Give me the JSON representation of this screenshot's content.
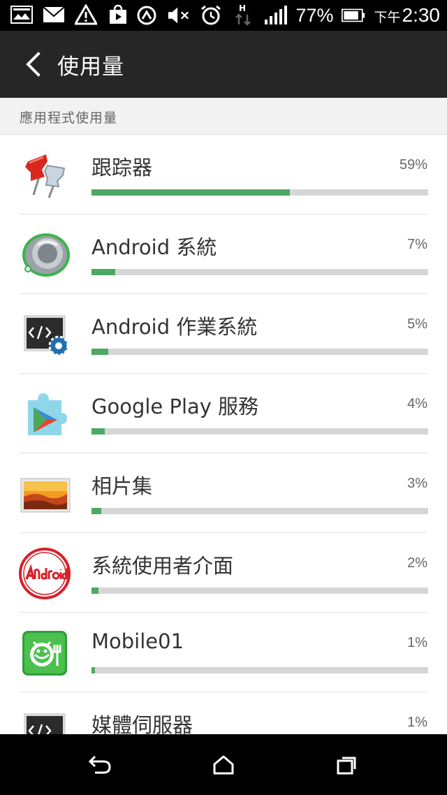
{
  "status_bar": {
    "battery_percent": "77%",
    "time_period": "下午",
    "time": "2:30",
    "icons": [
      "gallery-icon",
      "mail-icon",
      "warning-icon",
      "play-store-icon",
      "nfc-icon",
      "mute-icon",
      "alarm-icon",
      "data-transfer-icon",
      "signal-icon",
      "battery-icon"
    ]
  },
  "header": {
    "title": "使用量"
  },
  "section": {
    "title": "應用程式使用量"
  },
  "apps": [
    {
      "name": "跟踪器",
      "percent": "59%",
      "value": 0.59
    },
    {
      "name": "Android 系統",
      "percent": "7%",
      "value": 0.07
    },
    {
      "name": "Android 作業系統",
      "percent": "5%",
      "value": 0.05
    },
    {
      "name": "Google Play 服務",
      "percent": "4%",
      "value": 0.04
    },
    {
      "name": "相片集",
      "percent": "3%",
      "value": 0.03
    },
    {
      "name": "系統使用者介面",
      "percent": "2%",
      "value": 0.02
    },
    {
      "name": "Mobile01",
      "percent": "1%",
      "value": 0.01
    },
    {
      "name": "媒體伺服器",
      "percent": "1%",
      "value": 0.01
    }
  ],
  "colors": {
    "accent": "#4ca864",
    "track": "#d6d6d6",
    "action_bar": "#262626"
  },
  "nav": {
    "icons": [
      "back-icon",
      "home-icon",
      "recent-apps-icon"
    ]
  }
}
